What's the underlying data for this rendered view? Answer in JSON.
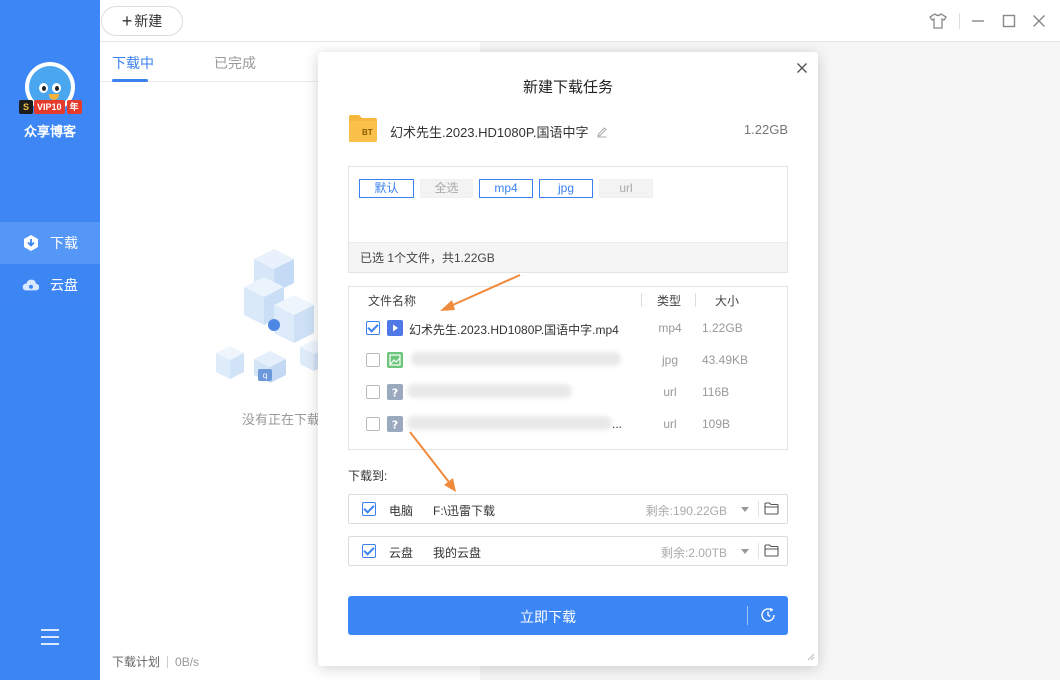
{
  "sidebar": {
    "username": "众享博客",
    "vip": {
      "s": "S",
      "label": "VIP10",
      "years": "年"
    },
    "items": [
      {
        "label": "下载",
        "icon": "download-icon",
        "active": true
      },
      {
        "label": "云盘",
        "icon": "cloud-icon",
        "active": false
      }
    ]
  },
  "topbar": {
    "new_label": "新建"
  },
  "main": {
    "tabs": [
      {
        "label": "下载中",
        "active": true
      },
      {
        "label": "已完成",
        "active": false
      }
    ],
    "empty_text": "没有正在下载的",
    "footer": {
      "plan": "下载计划",
      "speed": "0B/s"
    }
  },
  "dialog": {
    "title": "新建下载任务",
    "torrent": {
      "name": "幻术先生.2023.HD1080P.国语中字",
      "size": "1.22GB",
      "icon_label": "BT"
    },
    "filters": [
      {
        "label": "默认",
        "active": true
      },
      {
        "label": "全选",
        "active": false
      },
      {
        "label": "mp4",
        "active": true
      },
      {
        "label": "jpg",
        "active": true
      },
      {
        "label": "url",
        "active": false
      }
    ],
    "selected_summary": "已选 1个文件，共1.22GB",
    "table": {
      "headers": {
        "name": "文件名称",
        "type": "类型",
        "size": "大小"
      },
      "rows": [
        {
          "name": "幻术先生.2023.HD1080P.国语中字.mp4",
          "type": "mp4",
          "size": "1.22GB",
          "checked": true,
          "icon": "video-file-icon"
        },
        {
          "name": "",
          "type": "jpg",
          "size": "43.49KB",
          "checked": false,
          "icon": "image-file-icon"
        },
        {
          "name": "",
          "type": "url",
          "size": "116B",
          "checked": false,
          "icon": "unknown-file-icon"
        },
        {
          "name": "...",
          "type": "url",
          "size": "109B",
          "checked": false,
          "icon": "unknown-file-icon"
        }
      ]
    },
    "save_to_label": "下载到:",
    "destinations": [
      {
        "label": "电脑",
        "path": "F:\\迅雷下载",
        "free": "剩余:190.22GB",
        "checked": true
      },
      {
        "label": "云盘",
        "path": "我的云盘",
        "free": "剩余:2.00TB",
        "checked": true
      }
    ],
    "download_button": "立即下载"
  },
  "colors": {
    "accent": "#3b86f4",
    "sidebar": "#3d86f5",
    "arrow": "#f08a3c"
  }
}
